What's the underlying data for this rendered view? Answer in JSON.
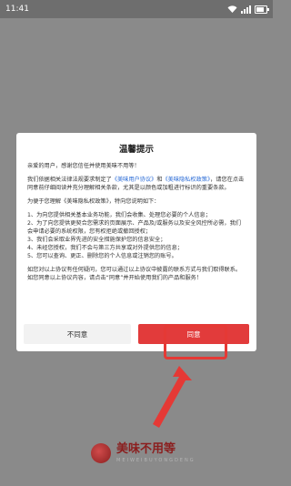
{
  "status_bar": {
    "time": "11:41"
  },
  "dialog": {
    "title": "温馨提示",
    "greeting": "亲爱的用户，感谢您信任并使用美味不用等！",
    "paragraph1_prefix": "我们依据相关法律法规要求制定了",
    "user_agreement_link": "《美味用户协议》",
    "and": "和",
    "privacy_policy_link": "《美味隐私权政策》",
    "paragraph1_suffix": "，请您在点击同意前仔细阅读并充分理解相关条款，尤其是以颜色或加粗进行标识的重要条款。",
    "paragraph2_intro": "为便于您理解《美味隐私权政策》，特向您说明如下：",
    "items": [
      "1、为向您提供相关基本业务功能，我们会收集、处理您必要的个人信息；",
      "2、为了向您提供更契合您需求的页面展示、产品及/或服务以及安全风控所必需，我们会申请必要的系统权限，您有权拒绝或撤回授权；",
      "3、我们会采取业界先进的安全措施保护您的信息安全；",
      "4、未经您授权，我们不会与第三方共享或对外提供您的信息；",
      "5、您可以查询、更正、删除您的个人信息或注销您的账号。"
    ],
    "closing": "如您对以上协议有任何疑问，您可以通过以上协议中披露的联系方式与我们取得联系。如您同意以上协议内容，请点击“同意”并开始使用我们的产品和服务！",
    "disagree_label": "不同意",
    "agree_label": "同意"
  },
  "brand": {
    "name": "美味不用等",
    "subtitle": "MEIWEIBUYONGDENG",
    "accent_color": "#8b1e1e"
  },
  "colors": {
    "primary_button": "#e23b3b",
    "link": "#2b6cd6",
    "annotation": "#e53935"
  }
}
